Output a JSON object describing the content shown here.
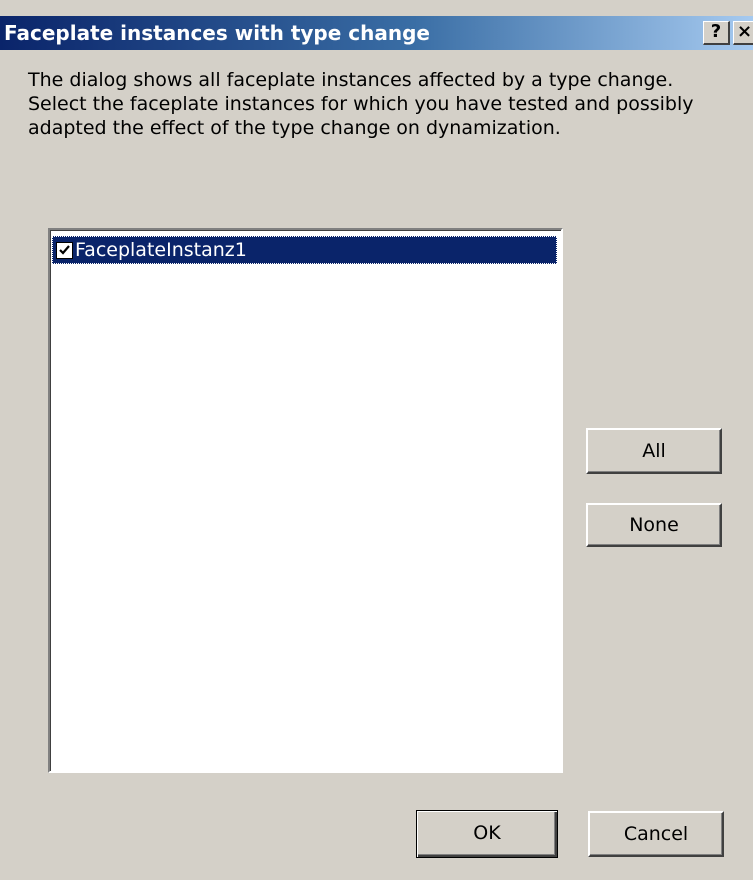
{
  "window": {
    "title": "Faceplate instances with type change",
    "help_glyph": "?",
    "close_glyph": "×"
  },
  "description": {
    "lines": [
      "The dialog shows all faceplate instances affected by a type change.",
      "Select the faceplate instances for which you have tested and possibly",
      "adapted the effect of the type change on dynamization."
    ]
  },
  "list": {
    "items": [
      {
        "label": "FaceplateInstanz1",
        "checked": true,
        "selected": true
      }
    ]
  },
  "buttons": {
    "all": "All",
    "none": "None",
    "ok": "OK",
    "cancel": "Cancel"
  },
  "colors": {
    "title_gradient_start": "#0a246a",
    "title_gradient_end": "#a6caf0",
    "selection": "#0a246a",
    "face": "#d4d0c8"
  }
}
